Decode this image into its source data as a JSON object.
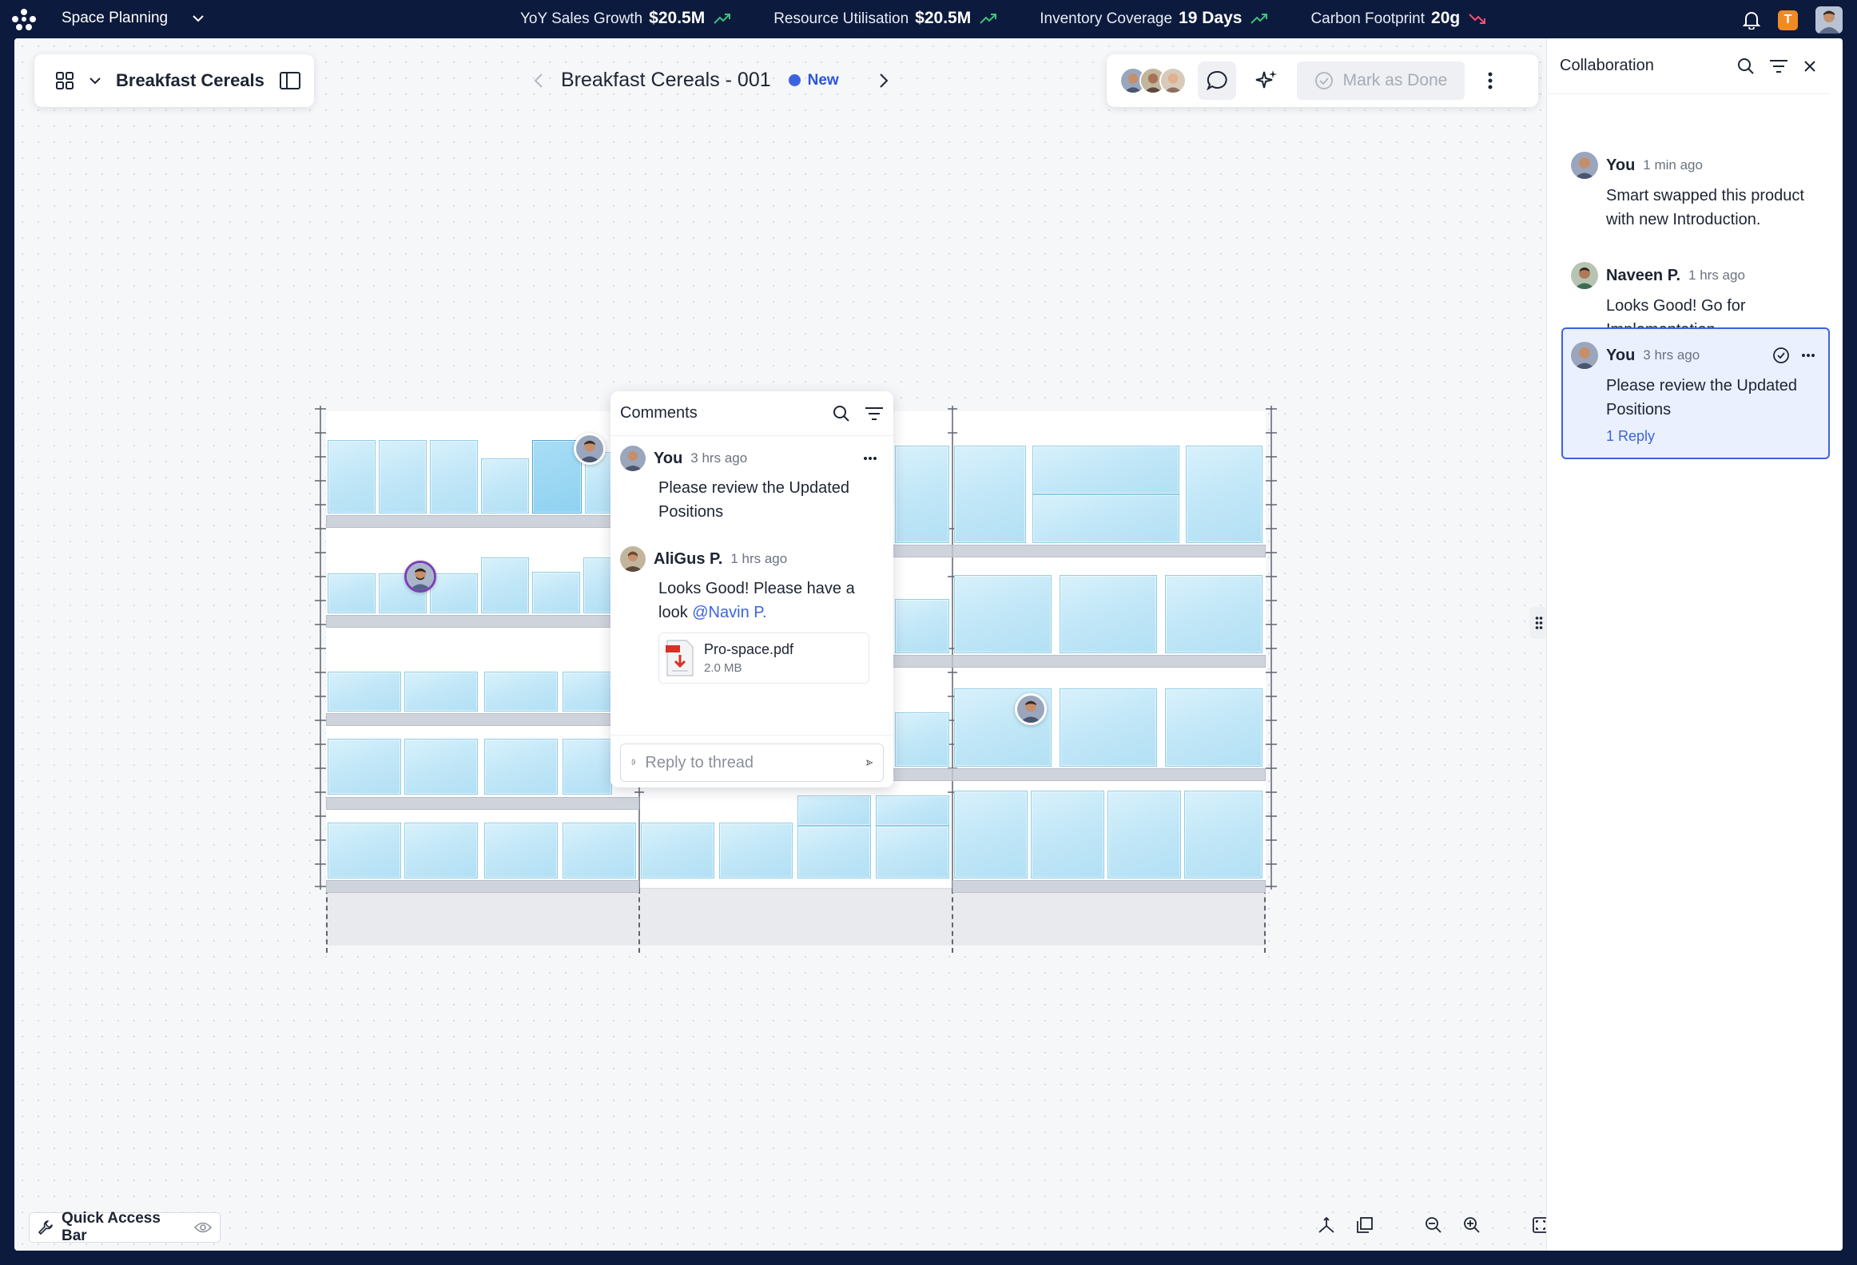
{
  "app": {
    "module": "Space Planning"
  },
  "kpis": [
    {
      "label": "YoY Sales Growth",
      "value": "$20.5M",
      "trend": "up",
      "color": "#3ec27a"
    },
    {
      "label": "Resource Utilisation",
      "value": "$20.5M",
      "trend": "up",
      "color": "#3ec27a"
    },
    {
      "label": "Inventory Coverage",
      "value": "19 Days",
      "trend": "up",
      "color": "#3ec27a"
    },
    {
      "label": "Carbon Footprint",
      "value": "20g",
      "trend": "down",
      "color": "#ff4d6a"
    }
  ],
  "user": {
    "initial": "T"
  },
  "toolbar": {
    "category": "Breakfast Cereals",
    "planogram_name": "Breakfast Cereals - 001",
    "status": "New",
    "mark_done_label": "Mark as Done"
  },
  "popup": {
    "title": "Comments",
    "comments": [
      {
        "author": "You",
        "time": "3 hrs ago",
        "text": "Please review the Updated Positions"
      },
      {
        "author": "AliGus P.",
        "time": "1 hrs ago",
        "text": "Looks Good! Please have a look ",
        "mention": "@Navin P."
      }
    ],
    "attachment": {
      "name": "Pro-space.pdf",
      "size": "2.0 MB"
    },
    "reply_placeholder": "Reply to thread"
  },
  "panel": {
    "title": "Collaboration",
    "comments": [
      {
        "author": "You",
        "time": "1 min ago",
        "text": "Smart swapped this product with new Introduction."
      },
      {
        "author": "Naveen P.",
        "time": "1 hrs ago",
        "text": "Looks Good! Go for Implementation."
      },
      {
        "author": "You",
        "time": "3 hrs ago",
        "text": "Please review the Updated Positions",
        "reply_label": "1 Reply"
      }
    ]
  },
  "bottom": {
    "quick_access_label": "Quick Access Bar"
  },
  "colors": {
    "accent": "#3b63e0",
    "navbar": "#0c1a3d",
    "product_fill": "#bfe6f7",
    "product_border": "#8fcde8"
  }
}
